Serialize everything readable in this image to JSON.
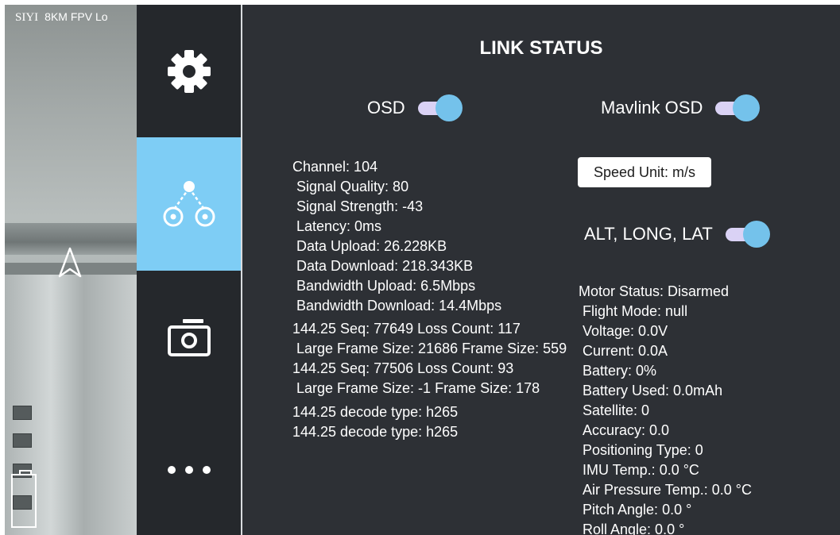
{
  "camera": {
    "brand": "SIYI",
    "title": "8KM FPV Lo"
  },
  "sidebar": {
    "items": [
      {
        "name": "settings",
        "icon": "gear-icon",
        "selected": false
      },
      {
        "name": "link",
        "icon": "link-nodes-icon",
        "selected": true
      },
      {
        "name": "camera",
        "icon": "camera-icon",
        "selected": false
      },
      {
        "name": "more",
        "icon": "more-dots-icon",
        "selected": false
      }
    ],
    "accent": "#7ecdf5"
  },
  "panel": {
    "title": "LINK STATUS",
    "toggles": {
      "osd": {
        "label": "OSD",
        "on": true
      },
      "mavlink_osd": {
        "label": "Mavlink OSD",
        "on": true
      },
      "alt_long_lat": {
        "label": "ALT, LONG, LAT",
        "on": true
      }
    },
    "speed_unit_button": "Speed Unit: m/s",
    "link_stats": [
      "Channel: 104",
      "Signal Quality: 80",
      "Signal Strength: -43",
      "Latency: 0ms",
      "Data Upload: 26.228KB",
      "Data Download: 218.343KB",
      "Bandwidth Upload: 6.5Mbps",
      "Bandwidth Download: 14.4Mbps",
      "144.25 Seq: 77649 Loss Count: 117",
      "Large Frame Size: 21686 Frame Size: 559",
      "144.25 Seq: 77506 Loss Count: 93",
      "Large Frame Size: -1 Frame Size: 178",
      "144.25 decode type: h265",
      "144.25 decode type: h265"
    ],
    "flight_stats": [
      "Motor Status: Disarmed",
      "Flight Mode: null",
      "Voltage: 0.0V",
      "Current: 0.0A",
      "Battery: 0%",
      "Battery Used: 0.0mAh",
      "Satellite: 0",
      "Accuracy: 0.0",
      "Positioning Type: 0",
      "IMU Temp.: 0.0 °C",
      "Air Pressure Temp.: 0.0 °C",
      "Pitch Angle: 0.0 °",
      "Roll Angle: 0.0 °"
    ]
  },
  "colors": {
    "panel_bg": "#2d3035",
    "sidebar_bg": "#25282c",
    "toggle_knob": "#74c2eb",
    "toggle_track": "#dad2f5"
  }
}
